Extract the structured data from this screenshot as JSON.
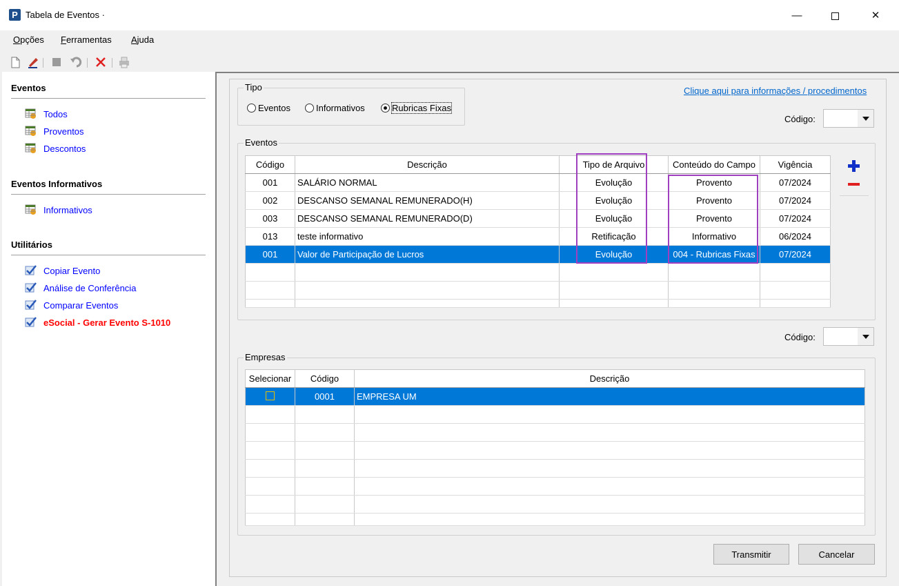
{
  "window": {
    "title": "Tabela de Eventos ·",
    "icon_letter": "P",
    "minimize_icon": "minimize-icon",
    "maximize_icon": "maximize-icon",
    "close_icon": "close-icon"
  },
  "menu": {
    "items": [
      {
        "pre": "",
        "u": "O",
        "post": "pções"
      },
      {
        "pre": "",
        "u": "F",
        "post": "erramentas"
      },
      {
        "pre": "",
        "u": "A",
        "post": "juda"
      }
    ]
  },
  "toolbar": {
    "icons": [
      "new-document-icon",
      "edit-pencil-icon",
      "stop-icon",
      "undo-icon",
      "delete-x-icon",
      "print-icon"
    ]
  },
  "sidebar": {
    "sections": [
      {
        "title": "Eventos",
        "items": [
          {
            "label": "Todos",
            "icon": "grid-icon"
          },
          {
            "label": "Proventos",
            "icon": "grid-icon"
          },
          {
            "label": "Descontos",
            "icon": "grid-icon"
          }
        ]
      },
      {
        "title": "Eventos Informativos",
        "items": [
          {
            "label": "Informativos",
            "icon": "grid-icon"
          }
        ]
      },
      {
        "title": "Utilitários",
        "items": [
          {
            "label": "Copiar Evento",
            "icon": "check-icon"
          },
          {
            "label": "Análise de Conferência",
            "icon": "check-icon"
          },
          {
            "label": "Comparar Eventos",
            "icon": "check-icon"
          },
          {
            "label": "eSocial - Gerar Evento S-1010",
            "icon": "check-icon",
            "highlight": true
          }
        ]
      }
    ]
  },
  "tipo": {
    "label": "Tipo",
    "options": [
      {
        "label": "Eventos",
        "selected": false
      },
      {
        "label": "Informativos",
        "selected": false
      },
      {
        "label": "Rubricas Fixas",
        "selected": true
      }
    ]
  },
  "info_link": "Clique aqui para informações / procedimentos",
  "codigo_label": "Código:",
  "eventos": {
    "label": "Eventos",
    "columns": [
      "Código",
      "Descrição",
      "Tipo de Arquivo",
      "Conteúdo do Campo",
      "Vigência"
    ],
    "rows": [
      [
        "001",
        "SALÁRIO NORMAL",
        "Evolução",
        "Provento",
        "07/2024"
      ],
      [
        "002",
        "DESCANSO SEMANAL REMUNERADO(H)",
        "Evolução",
        "Provento",
        "07/2024"
      ],
      [
        "003",
        "DESCANSO SEMANAL REMUNERADO(D)",
        "Evolução",
        "Provento",
        "07/2024"
      ],
      [
        "013",
        "teste informativo",
        "Retificação",
        "Informativo",
        "06/2024"
      ],
      [
        "001",
        "Valor de Participação de Lucros",
        "Evolução",
        "004 - Rubricas Fixas",
        "07/2024"
      ]
    ],
    "selected_row": 4
  },
  "empresas": {
    "label": "Empresas",
    "columns": [
      "Selecionar",
      "Código",
      "Descrição"
    ],
    "rows": [
      [
        "",
        "0001",
        "EMPRESA UM"
      ]
    ]
  },
  "buttons": {
    "transmitir": "Transmitir",
    "cancelar": "Cancelar"
  },
  "colors": {
    "selection": "#0078d7",
    "highlight_box": "#a040c0",
    "link": "#0000ff",
    "warning": "#ff0000"
  }
}
